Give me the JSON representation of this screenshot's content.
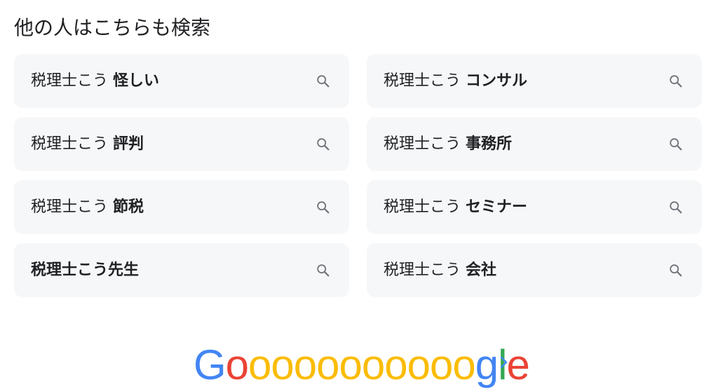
{
  "section": {
    "title": "他の人はこちらも検索"
  },
  "suggestions": [
    {
      "prefix": "税理士こう ",
      "suffix": "怪しい",
      "all_bold": false
    },
    {
      "prefix": "税理士こう ",
      "suffix": "コンサル",
      "all_bold": false
    },
    {
      "prefix": "税理士こう ",
      "suffix": "評判",
      "all_bold": false
    },
    {
      "prefix": "税理士こう ",
      "suffix": "事務所",
      "all_bold": false
    },
    {
      "prefix": "税理士こう ",
      "suffix": "節税",
      "all_bold": false
    },
    {
      "prefix": "税理士こう ",
      "suffix": "セミナー",
      "all_bold": false
    },
    {
      "prefix": "税理士こう",
      "suffix": "先生",
      "all_bold": true
    },
    {
      "prefix": "税理士こう ",
      "suffix": "会社",
      "all_bold": false
    }
  ],
  "icons": {
    "suggestion_icon": "search-icon",
    "next_icon": "chevron-right-icon"
  },
  "pagination": {
    "logo_letters": [
      "G",
      "o",
      "o",
      "o",
      "o",
      "o",
      "o",
      "o",
      "o",
      "o",
      "o",
      "o",
      "g",
      "l",
      "e"
    ],
    "logo_colors": [
      "#4285f4",
      "#ea4335",
      "#fbbc05",
      "#fbbc05",
      "#fbbc05",
      "#fbbc05",
      "#fbbc05",
      "#fbbc05",
      "#fbbc05",
      "#fbbc05",
      "#fbbc05",
      "#fbbc05",
      "#4285f4",
      "#34a853",
      "#ea4335"
    ]
  },
  "colors": {
    "chip_background": "#f6f7f9",
    "text": "#202124",
    "icon": "#70757a",
    "chevron": "#4285f4"
  }
}
